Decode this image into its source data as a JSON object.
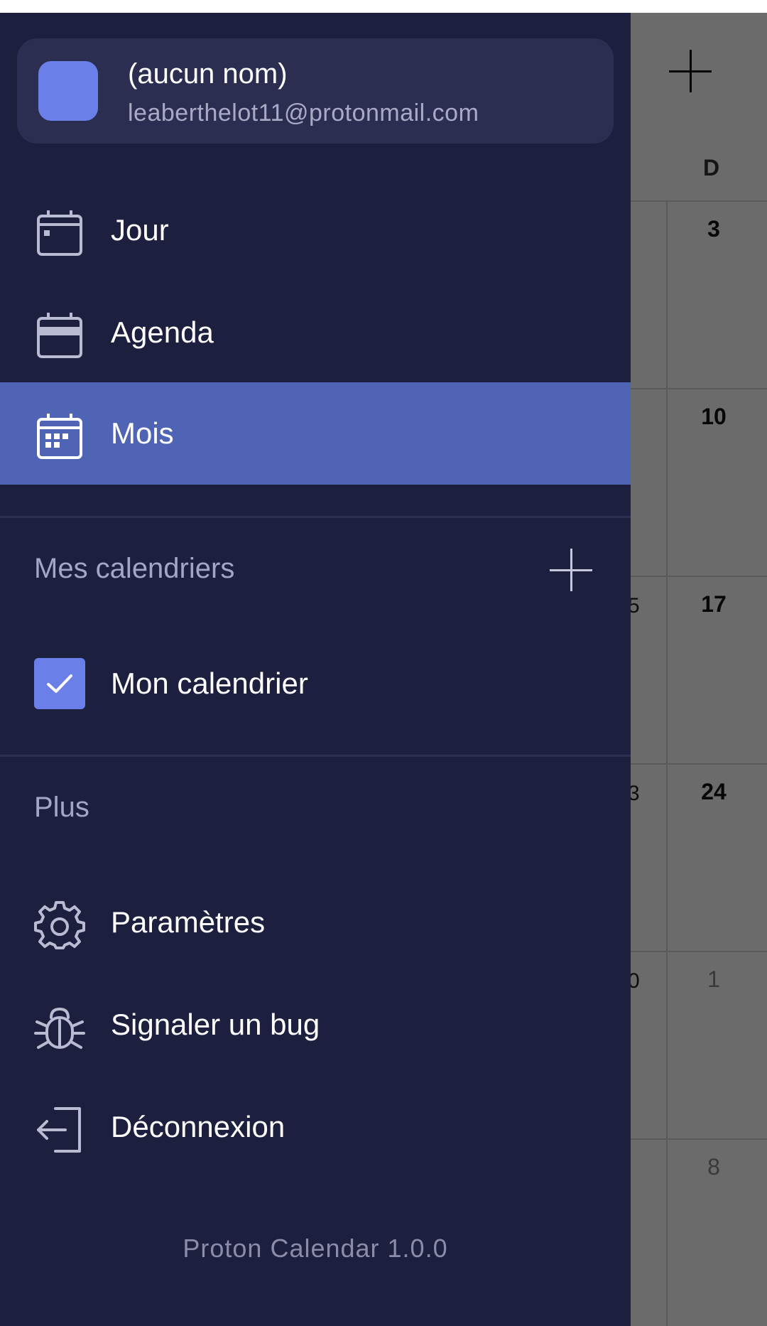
{
  "background": {
    "day_header": "D",
    "dates": [
      "3",
      "10",
      "17",
      "24",
      "1",
      "8"
    ],
    "peek_digits": [
      "5",
      "3",
      "0"
    ]
  },
  "drawer": {
    "account": {
      "name": "(aucun nom)",
      "email": "leaberthelot11@protonmail.com",
      "avatar_color": "#6b7fe8"
    },
    "views": [
      {
        "label": "Jour",
        "icon": "calendar-day-icon",
        "selected": false
      },
      {
        "label": "Agenda",
        "icon": "calendar-agenda-icon",
        "selected": false
      },
      {
        "label": "Mois",
        "icon": "calendar-month-icon",
        "selected": true
      }
    ],
    "my_calendars": {
      "title": "Mes calendriers",
      "items": [
        {
          "label": "Mon calendrier",
          "checked": true,
          "color": "#6b7fe8"
        }
      ]
    },
    "more": {
      "title": "Plus",
      "items": [
        {
          "label": "Paramètres",
          "icon": "gear-icon"
        },
        {
          "label": "Signaler un bug",
          "icon": "bug-icon"
        },
        {
          "label": "Déconnexion",
          "icon": "logout-icon"
        }
      ]
    },
    "version": "Proton Calendar 1.0.0"
  },
  "colors": {
    "drawer_bg": "#1d1f3e",
    "selected_bg": "#5064b6",
    "accent": "#6b7fe8"
  }
}
